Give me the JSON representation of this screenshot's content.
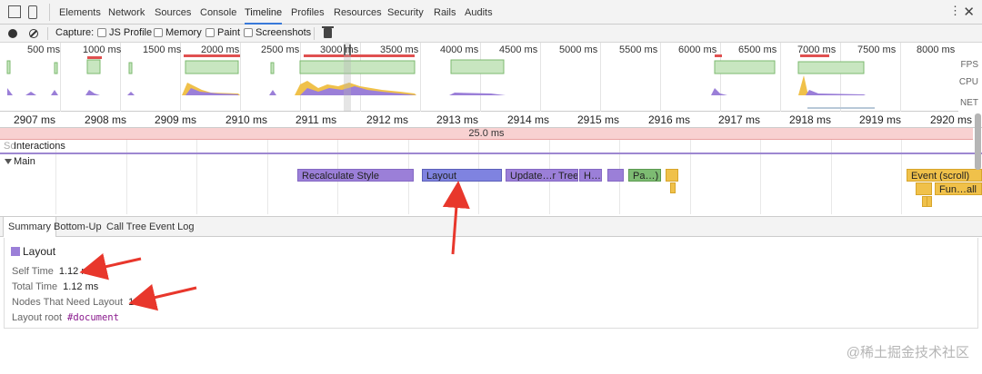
{
  "devtools": {
    "tabs": [
      "Elements",
      "Network",
      "Sources",
      "Console",
      "Timeline",
      "Profiles",
      "Resources",
      "Security",
      "Rails",
      "Audits"
    ],
    "active_tab": "Timeline"
  },
  "capture": {
    "label": "Capture:",
    "options": [
      {
        "label": "JS Profile",
        "checked": false
      },
      {
        "label": "Memory",
        "checked": false
      },
      {
        "label": "Paint",
        "checked": false
      },
      {
        "label": "Screenshots",
        "checked": false
      }
    ]
  },
  "overview": {
    "ticks": [
      "500 ms",
      "1000 ms",
      "1500 ms",
      "2000 ms",
      "2500 ms",
      "3000 ms",
      "3500 ms",
      "4000 ms",
      "4500 ms",
      "5000 ms",
      "5500 ms",
      "6000 ms",
      "6500 ms",
      "7000 ms",
      "7500 ms",
      "8000 ms"
    ],
    "tracks": [
      "FPS",
      "CPU",
      "NET"
    ]
  },
  "ruler": {
    "ticks": [
      "2907 ms",
      "2908 ms",
      "2909 ms",
      "2910 ms",
      "2911 ms",
      "2912 ms",
      "2913 ms",
      "2914 ms",
      "2915 ms",
      "2916 ms",
      "2917 ms",
      "2918 ms",
      "2919 ms",
      "2920 ms"
    ],
    "selection": "25.0 ms"
  },
  "tracks": {
    "interactions_prefix": "Sc",
    "interactions": "Interactions",
    "main": "Main"
  },
  "flame": {
    "recalc": "Recalculate Style",
    "layout": "Layout",
    "update_tree": "Update…r Tree",
    "h": "H…",
    "paint": "Pa…)",
    "event_scroll": "Event (scroll)",
    "fun_all": "Fun…all"
  },
  "details": {
    "tabs": [
      "Summary",
      "Bottom-Up",
      "Call Tree",
      "Event Log"
    ],
    "active": "Summary",
    "title": "Layout",
    "rows": [
      {
        "key": "Self Time",
        "value": "1.12 ms"
      },
      {
        "key": "Total Time",
        "value": "1.12 ms"
      },
      {
        "key": "Nodes That Need Layout",
        "value": "139"
      },
      {
        "key": "Layout root",
        "value": "#document"
      }
    ]
  },
  "colors": {
    "accent": "#3879d9",
    "layout": "#9b7fd8",
    "scripting": "#f0c14a",
    "painting": "#7dbb72",
    "selection": "#f8d1d1",
    "annotation_arrow": "#e8372c"
  },
  "watermark": "@稀土掘金技术社区"
}
